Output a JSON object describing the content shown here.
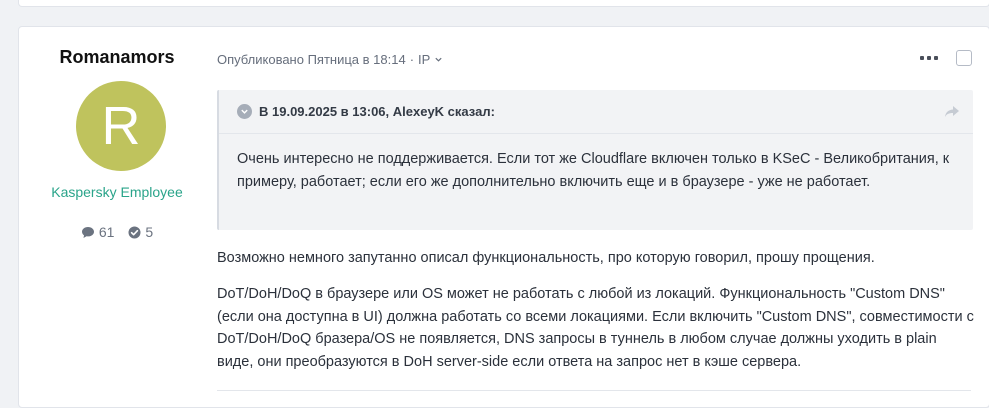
{
  "post": {
    "author": {
      "name": "Romanamors",
      "avatar_letter": "R",
      "avatar_color": "#bfc35d",
      "role": "Kaspersky Employee",
      "role_color": "#2aa48a",
      "comments_count": "61",
      "reputation_count": "5"
    },
    "meta": {
      "published": "Опубликовано Пятница в 18:14",
      "separator": "·",
      "ip_label": "IP"
    },
    "quote": {
      "header": "В 19.09.2025 в 13:06, AlexeyK сказал:",
      "body": "Очень интересно не поддерживается. Если тот же Cloudflare включен только в KSeC - Великобритания, к примеру, работает; если его же дополнительно включить еще и в браузере - уже не работает."
    },
    "paragraphs": [
      "Возможно немного запутанно описал функциональность, про которую говорил, прошу прощения.",
      "DoT/DoH/DoQ в браузере или OS может не работать с любой из локаций. Функциональность \"Custom DNS\" (если она доступна в UI) должна работать со всеми локациями. Если включить \"Custom DNS\", совместимости с DoT/DoH/DoQ бразера/OS не появляется, DNS запросы в туннель в любом случае должны уходить в plain виде, они преобразуются в DoH server-side если ответа на запрос нет в кэше сервера."
    ],
    "icons": {
      "comments": "comment-icon",
      "reputation": "check-circle-icon",
      "ip_menu": "chevron-down-icon",
      "menu": "ellipsis-icon",
      "quote_toggle": "chevron-down-icon",
      "share": "share-icon"
    }
  }
}
